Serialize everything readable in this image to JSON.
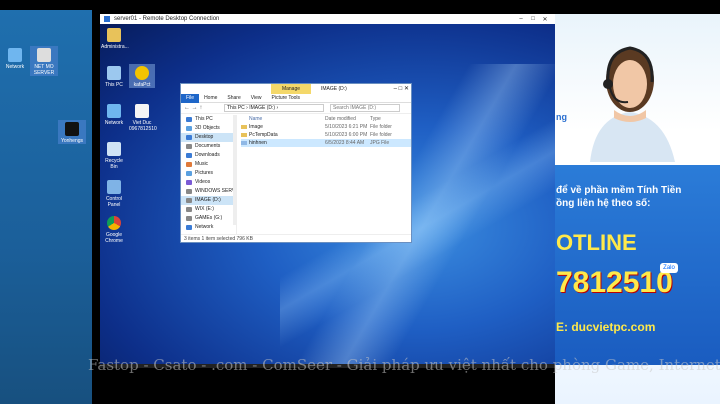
{
  "rdp": {
    "title": "server01 - Remote Desktop Connection",
    "min": "–",
    "max": "□",
    "close": "✕"
  },
  "outer_desktop": {
    "icons": [
      {
        "label": "Network",
        "icon": "network-icon"
      },
      {
        "label": "NET MO SERVER",
        "icon": "computer-icon"
      },
      {
        "label": "Yonhengs",
        "icon": "app-icon"
      }
    ]
  },
  "remote_desktop": {
    "icons": [
      {
        "label": "Administra...",
        "icon": "user-folder-icon"
      },
      {
        "label": "This PC",
        "icon": "this-pc-icon"
      },
      {
        "label": "kafaPct",
        "icon": "app-icon"
      },
      {
        "label": "Network",
        "icon": "network-icon"
      },
      {
        "label": "Viet Duc 0967812510",
        "icon": "text-file-icon"
      },
      {
        "label": "Recycle Bin",
        "icon": "recycle-bin-icon"
      },
      {
        "label": "Control Panel",
        "icon": "control-panel-icon"
      },
      {
        "label": "Google Chrome",
        "icon": "chrome-icon"
      }
    ]
  },
  "explorer": {
    "manage": "Manage",
    "title": "IMAGE (D:)",
    "ribbon": [
      "File",
      "Home",
      "Share",
      "View",
      "Picture Tools"
    ],
    "path": "This PC › IMAGE (D:) ›",
    "search_placeholder": "Search IMAGE (D:)",
    "nav": [
      {
        "label": "This PC",
        "color": "#3a7bd5"
      },
      {
        "label": "3D Objects",
        "color": "#5aa0e0"
      },
      {
        "label": "Desktop",
        "color": "#3a7bd5",
        "selected": true
      },
      {
        "label": "Documents",
        "color": "#888888"
      },
      {
        "label": "Downloads",
        "color": "#3a7bd5"
      },
      {
        "label": "Music",
        "color": "#e07a3a"
      },
      {
        "label": "Pictures",
        "color": "#5aa0e0"
      },
      {
        "label": "Videos",
        "color": "#7a5ad5"
      },
      {
        "label": "WINDOWS SERV",
        "color": "#888888"
      },
      {
        "label": "IMAGE (D:)",
        "color": "#888888"
      },
      {
        "label": "WIX (E:)",
        "color": "#888888"
      },
      {
        "label": "GAMEs (G:)",
        "color": "#888888"
      },
      {
        "label": "Network",
        "color": "#3a7bd5"
      }
    ],
    "columns": [
      "Name",
      "Date modified",
      "Type"
    ],
    "files": [
      {
        "name": "Image",
        "date": "5/10/2023 6:21 PM",
        "type": "File folder"
      },
      {
        "name": "PcTempData",
        "date": "5/10/2023 6:00 PM",
        "type": "File folder"
      },
      {
        "name": "hinhnen",
        "date": "6/5/2023 8:44 AM",
        "type": "JPG File"
      }
    ],
    "status": "3 items    1 item selected  796 KB"
  },
  "ad": {
    "blue_word": "ng",
    "line1": "để về phần mềm Tính Tiền",
    "line2": "ồng liên hệ theo số:",
    "hotline": "OTLINE",
    "phone": "7812510",
    "zalo": "Zalo",
    "web": "E: ducvietpc.com"
  },
  "watermark": "Fastop - Csato - .com - ComSeer - Giải pháp ưu việt nhất cho phòng Game, Internet"
}
